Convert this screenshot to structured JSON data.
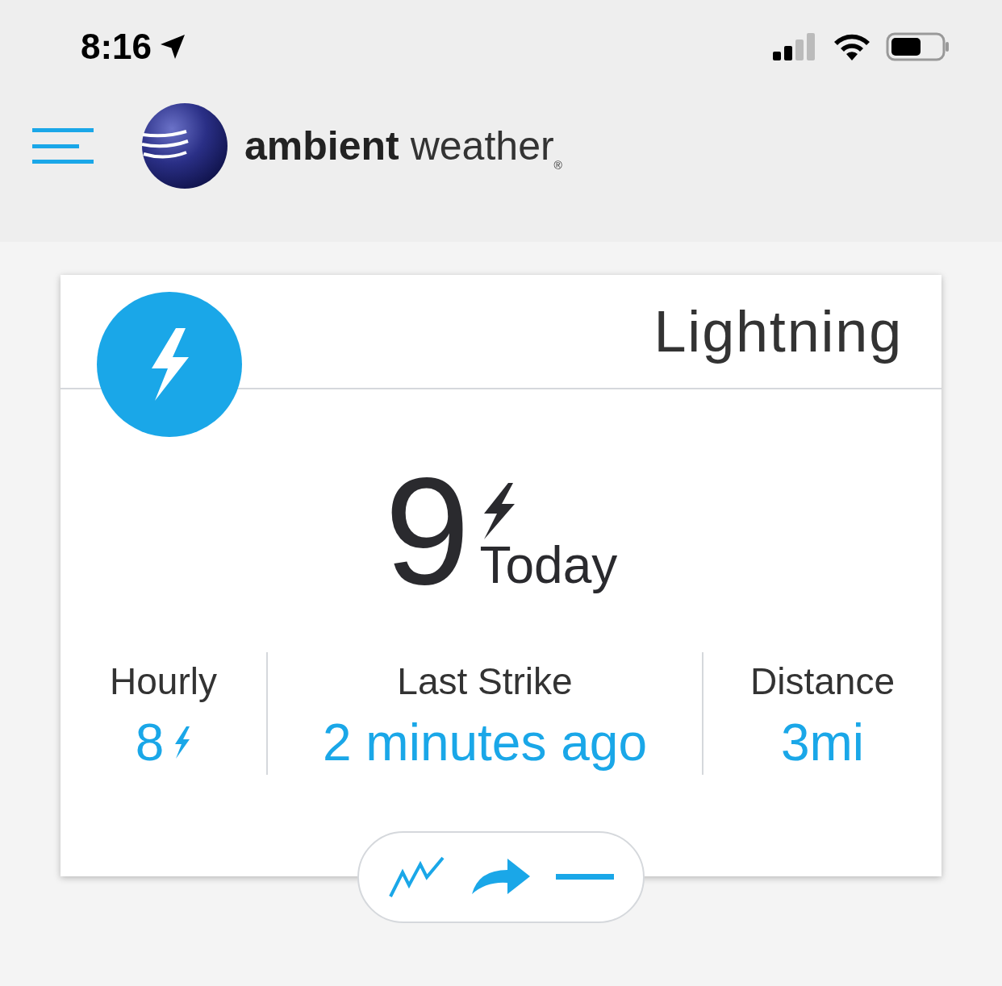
{
  "status_bar": {
    "time": "8:16"
  },
  "header": {
    "brand_bold": "ambient",
    "brand_light": "weather",
    "registered": "®"
  },
  "card": {
    "title": "Lightning",
    "today_count": "9",
    "today_label": "Today",
    "stats": [
      {
        "label": "Hourly",
        "value": "8",
        "kind": "count"
      },
      {
        "label": "Last Strike",
        "value": "2 minutes ago",
        "kind": "text"
      },
      {
        "label": "Distance",
        "value": "3mi",
        "kind": "text"
      }
    ]
  }
}
